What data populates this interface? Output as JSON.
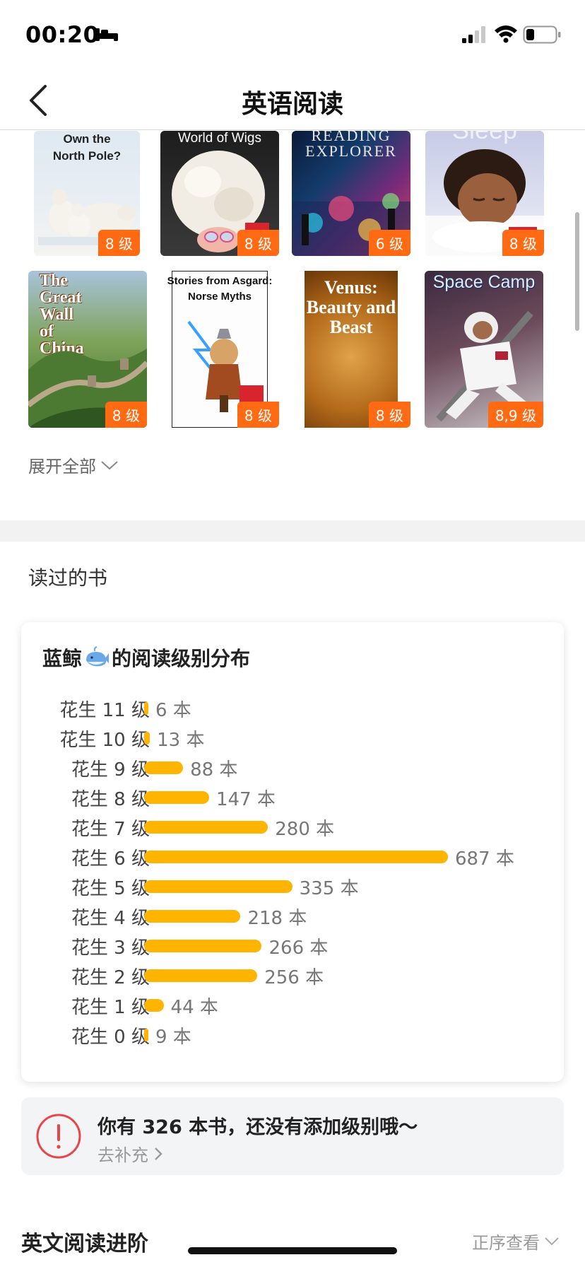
{
  "status_bar": {
    "time": "00:20"
  },
  "nav": {
    "title": "英语阅读"
  },
  "books_row1": [
    {
      "title": "Own the\nNorth Pole?",
      "level": "8 级"
    },
    {
      "title": "World of Wigs",
      "level": "8 级"
    },
    {
      "title": "READING\nEXPLORER",
      "level": "6 级"
    },
    {
      "title": "Sleep",
      "level": "8 级"
    }
  ],
  "books_row2": [
    {
      "title": "The\nGreat\nWall\nof\nChina",
      "level": "8 级"
    },
    {
      "title": "Stories from Asgard:\nNorse Myths",
      "level": "8 级"
    },
    {
      "title": "Venus:\nBeauty and Beast",
      "level": "8 级"
    },
    {
      "title": "Space Camp",
      "level": "8,9 级"
    }
  ],
  "expand": {
    "label": "展开全部"
  },
  "read_books": {
    "title": "读过的书"
  },
  "distribution": {
    "title_prefix": "蓝鲸",
    "title_suffix": "的阅读级别分布",
    "rows": [
      {
        "label": "花生 11 级",
        "count": "6 本"
      },
      {
        "label": "花生 10 级",
        "count": "13 本"
      },
      {
        "label": "花生 9 级",
        "count": "88 本"
      },
      {
        "label": "花生 8 级",
        "count": "147 本"
      },
      {
        "label": "花生 7 级",
        "count": "280 本"
      },
      {
        "label": "花生 6 级",
        "count": "687 本"
      },
      {
        "label": "花生 5 级",
        "count": "335 本"
      },
      {
        "label": "花生 4 级",
        "count": "218 本"
      },
      {
        "label": "花生 3 级",
        "count": "266 本"
      },
      {
        "label": "花生 2 级",
        "count": "256 本"
      },
      {
        "label": "花生 1 级",
        "count": "44 本"
      },
      {
        "label": "花生 0 级",
        "count": "9 本"
      }
    ]
  },
  "chart_data": {
    "type": "bar",
    "orientation": "horizontal",
    "categories": [
      "花生 11 级",
      "花生 10 级",
      "花生 9 级",
      "花生 8 级",
      "花生 7 级",
      "花生 6 级",
      "花生 5 级",
      "花生 4 级",
      "花生 3 级",
      "花生 2 级",
      "花生 1 级",
      "花生 0 级"
    ],
    "values": [
      6,
      13,
      88,
      147,
      280,
      687,
      335,
      218,
      266,
      256,
      44,
      9
    ],
    "title": "蓝鲸的阅读级别分布",
    "bar_color": "#ffb400"
  },
  "notice": {
    "text": "你有 326 本书，还没有添加级别哦～",
    "link": "去补充"
  },
  "advance": {
    "title": "英文阅读进阶",
    "order_label": "正序查看"
  },
  "colors": {
    "accent": "#ff6a13",
    "bar": "#ffb400",
    "alert": "#e8454b"
  }
}
